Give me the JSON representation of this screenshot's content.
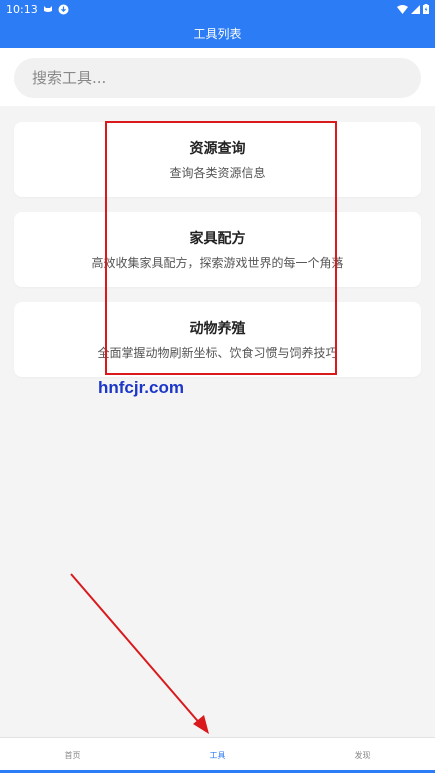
{
  "status_bar": {
    "time": "10:13",
    "bg_color": "#2b7cf5"
  },
  "app_bar": {
    "title": "工具列表"
  },
  "search": {
    "placeholder": "搜索工具..."
  },
  "cards": [
    {
      "title": "资源查询",
      "desc": "查询各类资源信息"
    },
    {
      "title": "家具配方",
      "desc": "高效收集家具配方，探索游戏世界的每一个角落"
    },
    {
      "title": "动物养殖",
      "desc": "全面掌握动物刷新坐标、饮食习惯与饲养技巧"
    }
  ],
  "watermark": "hnfcjr.com",
  "bottom_nav": {
    "items": [
      {
        "label": "首页"
      },
      {
        "label": "工具"
      },
      {
        "label": "发现"
      }
    ],
    "active_index": 1
  },
  "annotation_color": "#d9191c"
}
